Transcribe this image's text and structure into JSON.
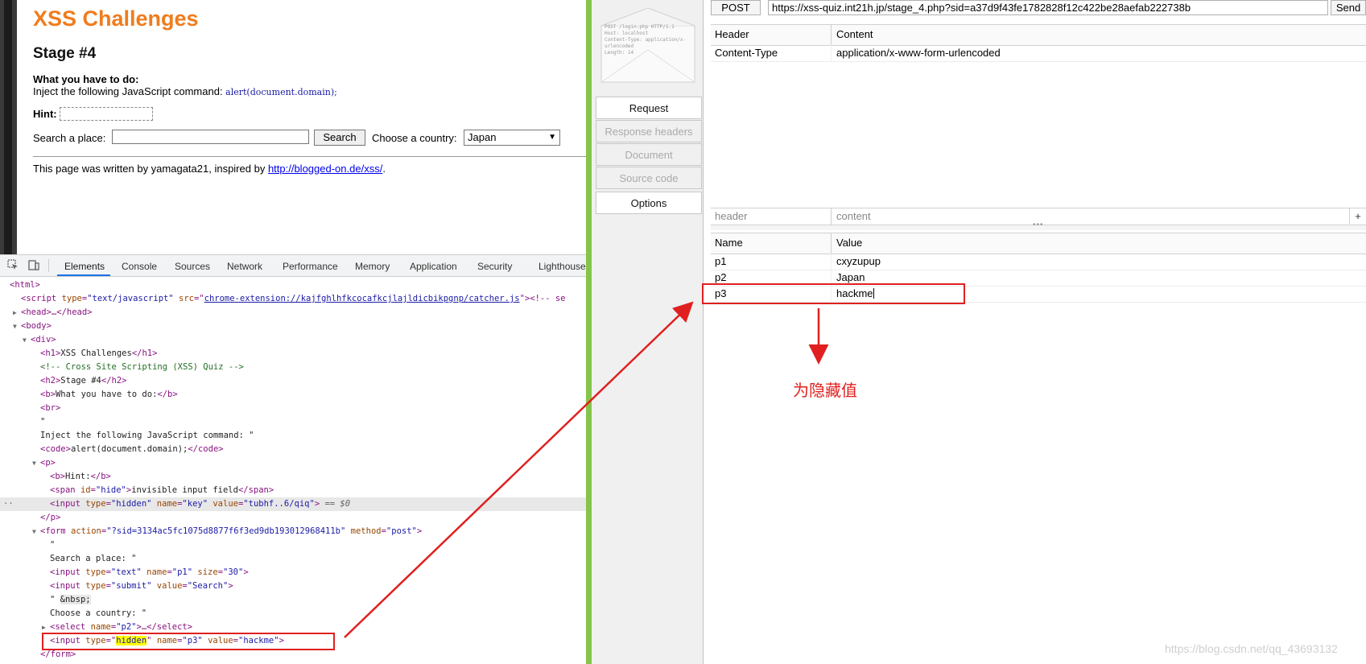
{
  "page": {
    "h1": "XSS Challenges",
    "h2": "Stage #4",
    "what": "What you have to do:",
    "inject_prefix": "Inject the following JavaScript command: ",
    "inject_code": "alert(document.domain);",
    "hint_label": "Hint:",
    "search_label": "Search a place:",
    "search_value": "",
    "search_button": "Search",
    "country_label": "Choose a country:",
    "country_selected": "Japan",
    "footer_prefix": "This page was written by yamagata21, inspired by ",
    "footer_link": "http://blogged-on.de/xss/",
    "footer_suffix": "."
  },
  "devtools": {
    "tabs": [
      "Elements",
      "Console",
      "Sources",
      "Network",
      "Performance",
      "Memory",
      "Application",
      "Security",
      "Lighthouse"
    ],
    "active_tab": "Elements",
    "icons": [
      "inspect-icon",
      "device-toolbar-icon"
    ]
  },
  "dom": {
    "l1": "<html>",
    "l2_tag_open": "<script ",
    "l2_a1": "type",
    "l2_v1": "\"text/javascript\"",
    "l2_a2": "src",
    "l2_v2": "chrome-extension://kajfghlhfkcocafkcjlajldicbikpgnp/catcher.js",
    "l2_tail": "><!-- se",
    "l3": "<head>…</head>",
    "l4": "<body>",
    "l5": "<div>",
    "l6_open": "<h1>",
    "l6_text": "XSS Challenges",
    "l6_close": "</h1>",
    "l7": "<!-- Cross Site Scripting (XSS) Quiz -->",
    "l8_open": "<h2>",
    "l8_text": "Stage #4",
    "l8_close": "</h2>",
    "l9_open": "<b>",
    "l9_text": "What you have to do:",
    "l9_close": "</b>",
    "l10": "<br>",
    "l11": "\"",
    "l12": "Inject the following JavaScript command: \"",
    "l13_open": "<code>",
    "l13_text": "alert(document.domain);",
    "l13_close": "</code>",
    "l14": "<p>",
    "l15_open": "<b>",
    "l15_text": "Hint:",
    "l15_close": "</b>",
    "l16_open": "<span ",
    "l16_a": "id",
    "l16_v": "\"hide\"",
    "l16_text": "invisible input field",
    "l16_close": "</span>",
    "l17_open": "<input ",
    "l17_a1": "type",
    "l17_v1": "\"hidden\"",
    "l17_a2": "name",
    "l17_v2": "\"key\"",
    "l17_a3": "value",
    "l17_v3": "\"tubhf..6/qiq\"",
    "l17_tail": "== $0",
    "l18": "</p>",
    "l19_open": "<form ",
    "l19_a1": "action",
    "l19_v1": "\"?sid=3134ac5fc1075d8877f6f3ed9db193012968411b\"",
    "l19_a2": "method",
    "l19_v2": "\"post\"",
    "l20": "\"",
    "l21": "Search a place: \"",
    "l22_open": "<input ",
    "l22_a1": "type",
    "l22_v1": "\"text\"",
    "l22_a2": "name",
    "l22_v2": "\"p1\"",
    "l22_a3": "size",
    "l22_v3": "\"30\"",
    "l23_open": "<input ",
    "l23_a1": "type",
    "l23_v1": "\"submit\"",
    "l23_a2": "value",
    "l23_v2": "\"Search\"",
    "l24_a": "\" ",
    "l24_b": "&nbsp;",
    "l25": "Choose a country: \"",
    "l26_open": "<select ",
    "l26_a": "name",
    "l26_v": "\"p2\"",
    "l26_tail": ">…</select>",
    "l27_open": "<input ",
    "l27_a1": "type",
    "l27_v1": "hidden",
    "l27_a2": "name",
    "l27_v2": "\"p3\"",
    "l27_a3": "value",
    "l27_v3": "\"hackme\"",
    "l28": "</form>"
  },
  "hackbar": {
    "method": "POST",
    "url": "https://xss-quiz.int21h.jp/stage_4.php?sid=a37d9f43fe1782828f12c422be28aefab222738b",
    "send": "Send",
    "side_buttons": [
      "Request",
      "Response headers",
      "Document",
      "Source code",
      "Options"
    ],
    "header_col1": "Header",
    "header_col2": "Content",
    "header_rows": [
      {
        "name": "Content-Type",
        "value": "application/x-www-form-urlencoded"
      }
    ],
    "header_input_placeholder1": "header",
    "header_input_placeholder2": "content",
    "add_symbol": "+",
    "splitter_dots": "•••",
    "param_col1": "Name",
    "param_col2": "Value",
    "params": [
      {
        "name": "p1",
        "value": "cxyzupup"
      },
      {
        "name": "p2",
        "value": "Japan"
      },
      {
        "name": "p3",
        "value": "hackme"
      }
    ],
    "envelope_text": [
      "POST /login.php HTTP/1.1",
      "Host: localhost",
      "Content-Type: application/x-",
      "urlencoded",
      "Length: 14"
    ]
  },
  "annotation": {
    "text": "为隐藏值",
    "color": "#e02020"
  },
  "watermark": "https://blog.csdn.net/qq_43693132",
  "colors": {
    "accent_orange": "#f07c1d",
    "separator_green": "#85c44a",
    "tab_active": "#1a73e8"
  }
}
